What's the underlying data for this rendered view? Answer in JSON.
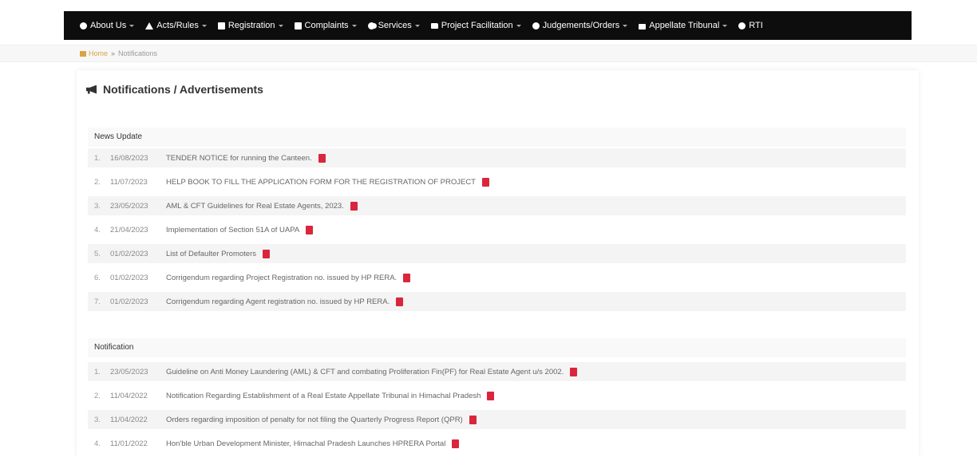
{
  "nav": {
    "items": [
      {
        "label": "About Us",
        "icon": "info-circle-icon"
      },
      {
        "label": "Acts/Rules",
        "icon": "sitemap-icon"
      },
      {
        "label": "Registration",
        "icon": "clipboard-icon"
      },
      {
        "label": "Complaints",
        "icon": "clipboard-icon"
      },
      {
        "label": "Services",
        "icon": "cogs-icon"
      },
      {
        "label": "Project Facilitation",
        "icon": "folder-icon"
      },
      {
        "label": "Judgements/Orders",
        "icon": "info-circle-icon"
      },
      {
        "label": "Appellate Tribunal",
        "icon": "calendar-icon"
      },
      {
        "label": "RTI",
        "icon": "info-circle-icon"
      }
    ]
  },
  "breadcrumb": {
    "home": "Home",
    "separator": "»",
    "current": "Notifications"
  },
  "page": {
    "title": "Notifications / Advertisements"
  },
  "news": {
    "heading": "News Update",
    "items": [
      {
        "num": "1.",
        "date": "16/08/2023",
        "text": "TENDER NOTICE for running the Canteen."
      },
      {
        "num": "2.",
        "date": "11/07/2023",
        "text": "HELP BOOK TO FILL THE APPLICATION FORM FOR THE REGISTRATION OF PROJECT"
      },
      {
        "num": "3.",
        "date": "23/05/2023",
        "text": "AML & CFT Guidelines for Real Estate Agents, 2023."
      },
      {
        "num": "4.",
        "date": "21/04/2023",
        "text": "Implementation of Section 51A of UAPA"
      },
      {
        "num": "5.",
        "date": "01/02/2023",
        "text": "List of Defaulter Promoters"
      },
      {
        "num": "6.",
        "date": "01/02/2023",
        "text": "Corrigendum regarding Project Registration no. issued by HP RERA."
      },
      {
        "num": "7.",
        "date": "01/02/2023",
        "text": "Corrigendum regarding Agent registration no. issued by HP RERA."
      }
    ]
  },
  "notification": {
    "heading": "Notification",
    "items": [
      {
        "num": "1.",
        "date": "23/05/2023",
        "text": "Guideline on Anti Money Laundering (AML) & CFT and combating Proliferation Fin(PF) for Real Estate Agent u/s 2002."
      },
      {
        "num": "2.",
        "date": "11/04/2022",
        "text": "Notification Regarding Establishment of a Real Estate Appellate Tribunal in Himachal Pradesh"
      },
      {
        "num": "3.",
        "date": "11/04/2022",
        "text": "Orders regarding imposition of penalty for not filing the Quarterly Progress Report (QPR)"
      },
      {
        "num": "4.",
        "date": "11/01/2022",
        "text": "Hon'ble Urban Development Minister, Himachal Pradesh Launches HPRERA Portal"
      }
    ]
  },
  "colors": {
    "navbar": "#0d0d0d",
    "pdf": "#d9263d",
    "breadcrumb_home": "#d9a441"
  }
}
